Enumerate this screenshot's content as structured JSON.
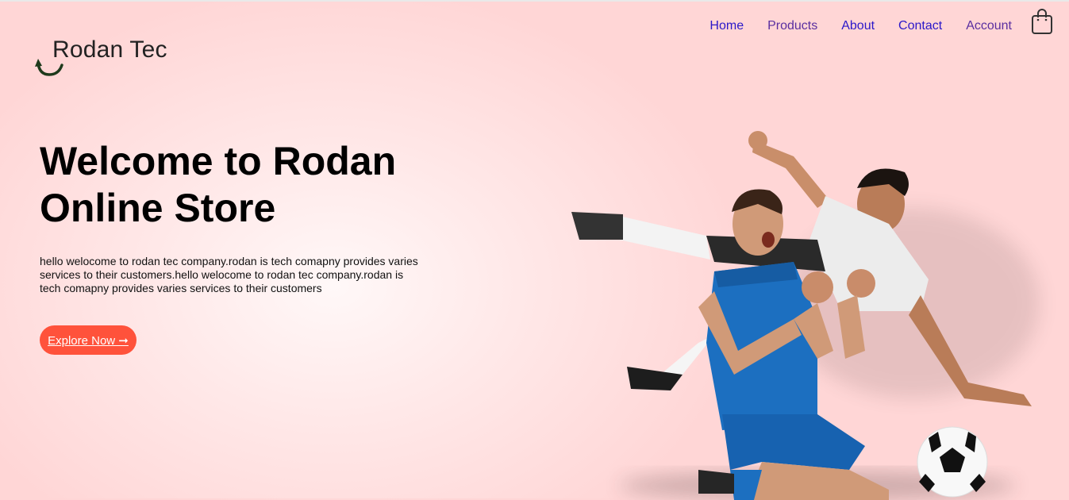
{
  "brand": {
    "name": "Rodan Tec",
    "logo_icon": "curved-arrow-icon",
    "accent_color": "#2f4b2a"
  },
  "nav": {
    "items": [
      {
        "label": "Home"
      },
      {
        "label": "Products"
      },
      {
        "label": "About"
      },
      {
        "label": "Contact"
      },
      {
        "label": "Account"
      }
    ],
    "cart_icon": "shopping-bag-icon"
  },
  "hero": {
    "title_line1": "Welcome to Rodan",
    "title_line2": "Online Store",
    "description": "hello welocome to rodan tec company.rodan is tech comapny provides varies services to their customers.hello welocome to rodan tec company.rodan is tech comapny provides varies services to their customers",
    "cta_label": "Explore Now ➞",
    "cta_color": "#ff523b",
    "image": "football-players-illustration"
  }
}
